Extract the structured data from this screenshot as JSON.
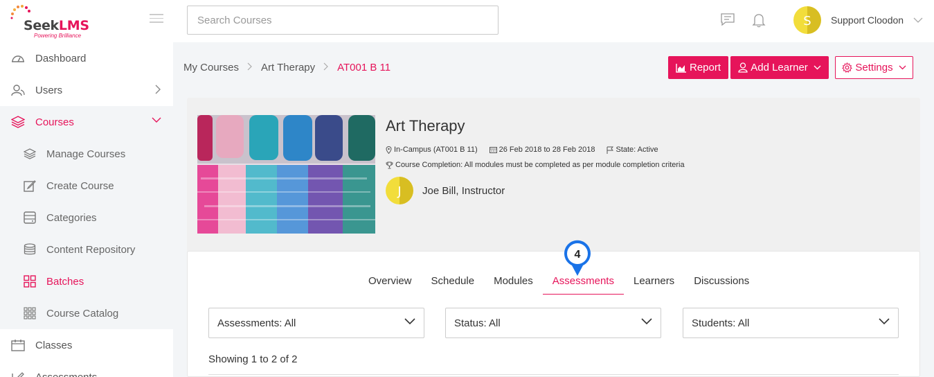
{
  "brand": {
    "name_part1": "Seek",
    "name_part2": "LMS",
    "tagline": "Powering Brilliance",
    "accent_color": "#e6145a"
  },
  "sidebar": {
    "items": [
      {
        "label": "Dashboard",
        "icon": "dashboard-icon"
      },
      {
        "label": "Users",
        "icon": "users-icon"
      },
      {
        "label": "Courses",
        "icon": "layers-icon"
      },
      {
        "label": "Classes",
        "icon": "calendar-icon"
      },
      {
        "label": "Assessments",
        "icon": "edit-icon"
      }
    ],
    "sub_items": [
      {
        "label": "Manage Courses",
        "icon": "layers-icon"
      },
      {
        "label": "Create Course",
        "icon": "edit-icon"
      },
      {
        "label": "Categories",
        "icon": "categories-icon"
      },
      {
        "label": "Content Repository",
        "icon": "database-icon"
      },
      {
        "label": "Batches",
        "icon": "grid-icon"
      },
      {
        "label": "Course Catalog",
        "icon": "grid-small-icon"
      }
    ]
  },
  "header": {
    "search_placeholder": "Search Courses",
    "user_name": "Support Cloodon",
    "avatar_initial": "S"
  },
  "breadcrumb": [
    "My Courses",
    "Art Therapy",
    "AT001 B 11"
  ],
  "actions": {
    "report": "Report",
    "add_learner": "Add Learner",
    "settings": "Settings"
  },
  "course": {
    "title": "Art Therapy",
    "location": "In-Campus (AT001 B 11)",
    "dates": "26 Feb 2018 to 28 Feb 2018",
    "state": "State: Active",
    "completion": "Course Completion: All modules must be completed as per module completion criteria",
    "instructor": "Joe Bill, Instructor",
    "instructor_initial": "J"
  },
  "tabs": [
    "Overview",
    "Schedule",
    "Modules",
    "Assessments",
    "Learners",
    "Discussions"
  ],
  "marker_number": "4",
  "filters": {
    "assessments": "Assessments: All",
    "status": "Status: All",
    "students": "Students: All"
  },
  "showing": "Showing 1 to 2 of 2"
}
